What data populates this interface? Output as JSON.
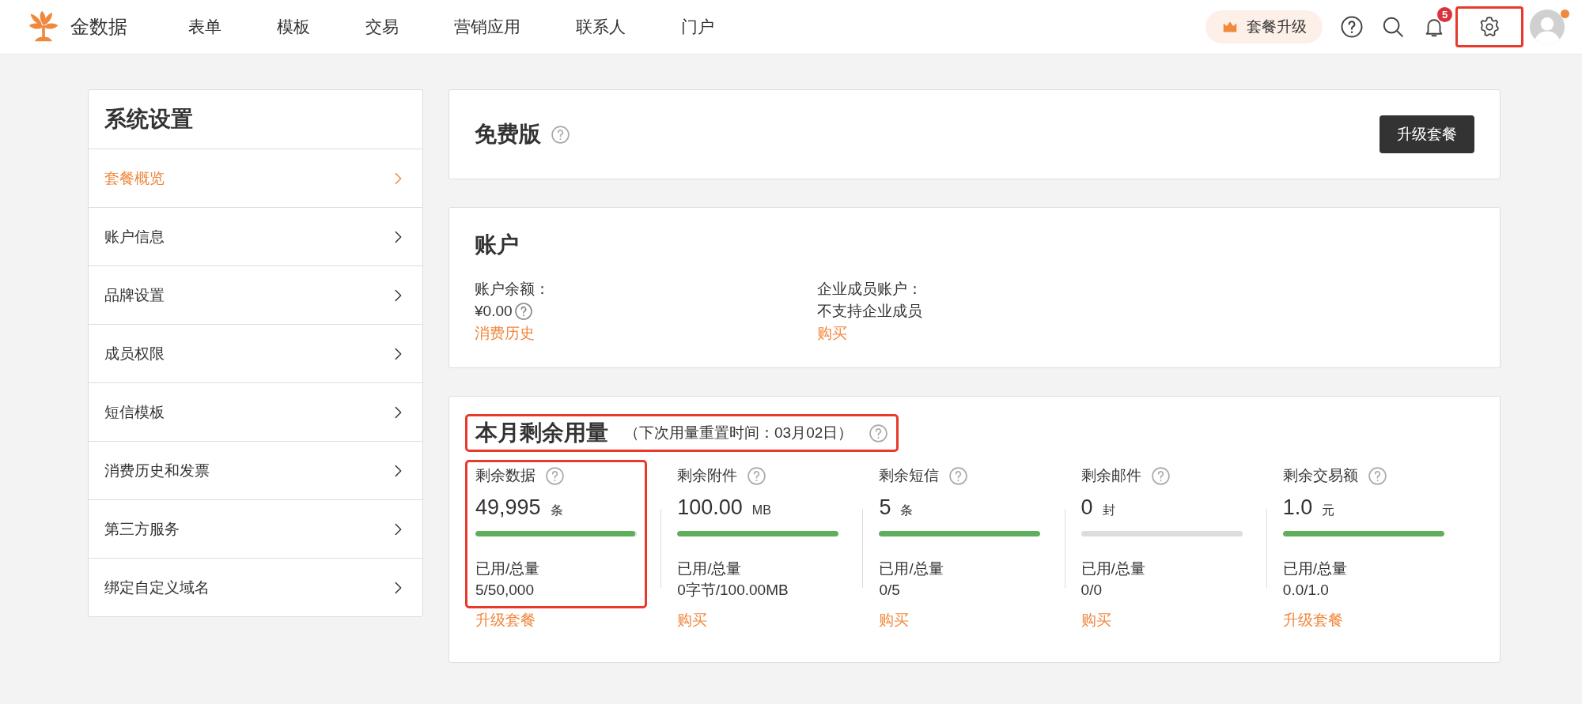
{
  "header": {
    "logo_text": "金数据",
    "nav": [
      {
        "label": "表单"
      },
      {
        "label": "模板"
      },
      {
        "label": "交易"
      },
      {
        "label": "营销应用"
      },
      {
        "label": "联系人"
      },
      {
        "label": "门户"
      }
    ],
    "upgrade_button": "套餐升级",
    "notification_badge": "5",
    "settings_highlighted": true,
    "avatar_dot": true
  },
  "sidebar": {
    "title": "系统设置",
    "items": [
      {
        "label": "套餐概览",
        "selected": true
      },
      {
        "label": "账户信息",
        "selected": false
      },
      {
        "label": "品牌设置",
        "selected": false
      },
      {
        "label": "成员权限",
        "selected": false
      },
      {
        "label": "短信模板",
        "selected": false
      },
      {
        "label": "消费历史和发票",
        "selected": false
      },
      {
        "label": "第三方服务",
        "selected": false
      },
      {
        "label": "绑定自定义域名",
        "selected": false
      }
    ]
  },
  "plan_card": {
    "title": "免费版",
    "button": "升级套餐"
  },
  "account_card": {
    "title": "账户",
    "fields": [
      {
        "label": "账户余额：",
        "value": "¥0.00",
        "help": true,
        "link": "消费历史"
      },
      {
        "label": "企业成员账户：",
        "value": "不支持企业成员",
        "help": false,
        "link": "购买"
      }
    ]
  },
  "usage_card": {
    "title": "本月剩余用量",
    "subtitle": "（下次用量重置时间：03月02日）",
    "title_highlighted": true,
    "stats": [
      {
        "label": "剩余数据",
        "amount": "49,995",
        "unit": "条",
        "level": 0.99,
        "used_label": "已用/总量",
        "used": "5/50,000",
        "link": "升级套餐",
        "highlighted": true
      },
      {
        "label": "剩余附件",
        "amount": "100.00",
        "unit": "MB",
        "level": 1,
        "used_label": "已用/总量",
        "used": "0字节/100.00MB",
        "link": "购买",
        "highlighted": false
      },
      {
        "label": "剩余短信",
        "amount": "5",
        "unit": "条",
        "level": 1,
        "used_label": "已用/总量",
        "used": "0/5",
        "link": "购买",
        "highlighted": false
      },
      {
        "label": "剩余邮件",
        "amount": "0",
        "unit": "封",
        "level": 0,
        "used_label": "已用/总量",
        "used": "0/0",
        "link": "购买",
        "highlighted": false
      },
      {
        "label": "剩余交易额",
        "amount": "1.0",
        "unit": "元",
        "level": 1,
        "used_label": "已用/总量",
        "used": "0.0/1.0",
        "link": "升级套餐",
        "highlighted": false
      }
    ]
  }
}
